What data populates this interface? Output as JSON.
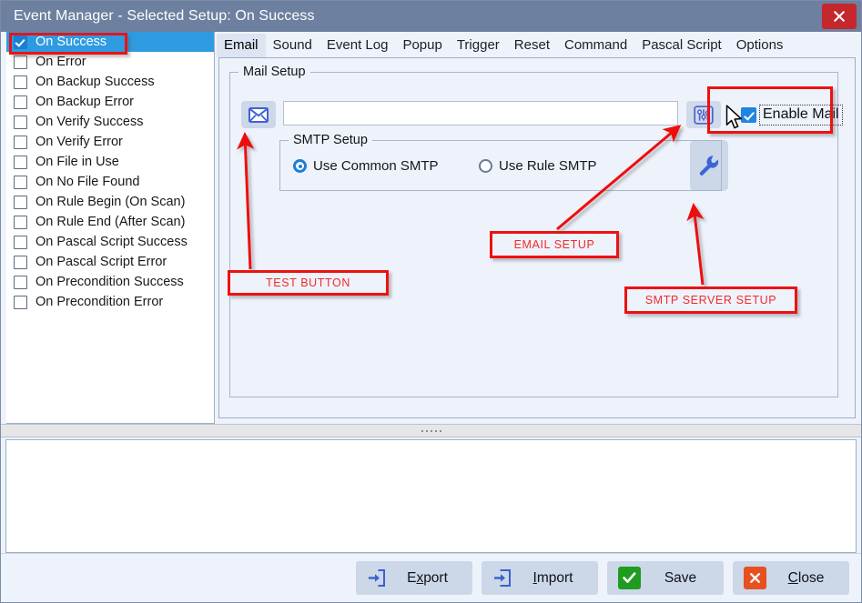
{
  "window": {
    "title": "Event Manager - Selected Setup: On Success",
    "close_icon": "close-x-icon"
  },
  "event_list": {
    "items": [
      {
        "label": "On Success",
        "checked": true,
        "selected": true
      },
      {
        "label": "On Error",
        "checked": false,
        "selected": false
      },
      {
        "label": "On Backup Success",
        "checked": false,
        "selected": false
      },
      {
        "label": "On Backup Error",
        "checked": false,
        "selected": false
      },
      {
        "label": "On Verify Success",
        "checked": false,
        "selected": false
      },
      {
        "label": "On Verify Error",
        "checked": false,
        "selected": false
      },
      {
        "label": "On File in Use",
        "checked": false,
        "selected": false
      },
      {
        "label": "On No File Found",
        "checked": false,
        "selected": false
      },
      {
        "label": "On Rule Begin (On Scan)",
        "checked": false,
        "selected": false
      },
      {
        "label": "On Rule End (After Scan)",
        "checked": false,
        "selected": false
      },
      {
        "label": "On Pascal Script Success",
        "checked": false,
        "selected": false
      },
      {
        "label": "On Pascal Script Error",
        "checked": false,
        "selected": false
      },
      {
        "label": "On Precondition Success",
        "checked": false,
        "selected": false
      },
      {
        "label": "On Precondition Error",
        "checked": false,
        "selected": false
      }
    ]
  },
  "tabs": [
    {
      "label": "Email",
      "active": true
    },
    {
      "label": "Sound",
      "active": false
    },
    {
      "label": "Event Log",
      "active": false
    },
    {
      "label": "Popup",
      "active": false
    },
    {
      "label": "Trigger",
      "active": false
    },
    {
      "label": "Reset",
      "active": false
    },
    {
      "label": "Command",
      "active": false
    },
    {
      "label": "Pascal Script",
      "active": false
    },
    {
      "label": "Options",
      "active": false
    }
  ],
  "email_tab": {
    "mail_setup_title": "Mail Setup",
    "mail_address_value": "",
    "mail_address_placeholder": "",
    "test_button_icon": "envelope-icon",
    "email_setup_button_icon": "sliders-icon",
    "smtp_server_setup_button_icon": "wrench-icon",
    "enable_mail_label": "Enable Mail",
    "enable_mail_checked": true,
    "smtp_setup": {
      "title": "SMTP Setup",
      "options": [
        {
          "label": "Use Common SMTP",
          "selected": true
        },
        {
          "label": "Use Rule SMTP",
          "selected": false
        }
      ]
    }
  },
  "footer": {
    "buttons": [
      {
        "label": "Export",
        "accel": "x",
        "icon": "export-arrow-icon"
      },
      {
        "label": "Import",
        "accel": "I",
        "icon": "import-arrow-icon"
      },
      {
        "label": "Save",
        "accel": "",
        "icon": "green-check-icon"
      },
      {
        "label": "Close",
        "accel": "C",
        "icon": "orange-x-icon"
      }
    ]
  },
  "annotations": {
    "test_button": "TEST BUTTON",
    "email_setup": "EMAIL SETUP",
    "smtp_server_setup": "SMTP SERVER SETUP",
    "highlight_color": "#ee1111"
  }
}
